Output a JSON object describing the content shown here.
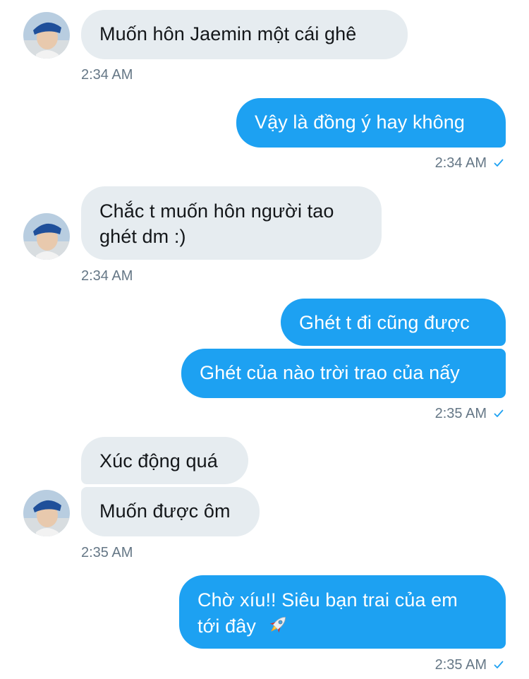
{
  "messages": [
    {
      "text": "Muốn hôn Jaemin một cái ghê"
    },
    {
      "text": "Vậy là đồng ý hay không"
    },
    {
      "line1": "Chắc t muốn hôn người tao",
      "line2": "ghét dm :)"
    },
    {
      "text": "Ghét t đi cũng được"
    },
    {
      "text": "Ghét của nào trời trao của nấy"
    },
    {
      "text": "Xúc động quá"
    },
    {
      "text": "Muốn được ôm"
    },
    {
      "line1": "Chờ xíu!! Siêu bạn trai của em",
      "line2": "tới đây",
      "emoji": "rocket"
    }
  ],
  "timestamps": [
    "2:34 AM",
    "2:34 AM",
    "2:34 AM",
    "2:35 AM",
    "2:35 AM",
    "2:35 AM"
  ],
  "colors": {
    "incoming_bubble": "#e6ecf0",
    "outgoing_bubble": "#1da1f2",
    "timestamp": "#657786",
    "read_check": "#1da1f2"
  },
  "icons": {
    "read_receipt": "check-icon",
    "avatar": "user-avatar-photo"
  }
}
